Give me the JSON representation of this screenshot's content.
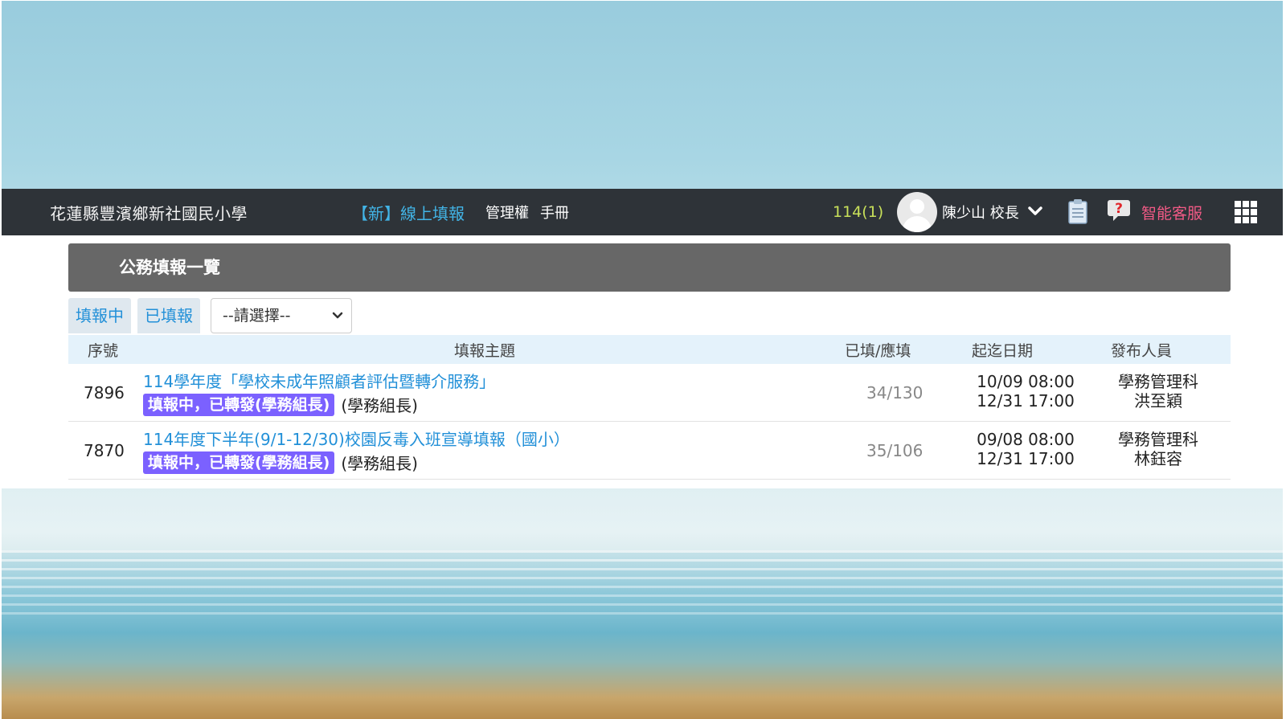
{
  "navbar": {
    "school_name": "花蓮縣豐濱鄉新社國民小學",
    "system_title": "【新】線上填報",
    "admin_link": "管理權",
    "manual_link": "手冊",
    "term": "114(1)",
    "user_name": "陳少山 校長",
    "ai_service": "智能客服",
    "icons": [
      "avatar-icon",
      "chevron-down-icon",
      "clipboard-icon",
      "help-icon",
      "apps-grid-icon"
    ]
  },
  "panel": {
    "title": "公務填報一覽"
  },
  "tabs": [
    {
      "label": "填報中"
    },
    {
      "label": "已填報"
    }
  ],
  "filter_select": {
    "selected": "--請選擇--"
  },
  "table": {
    "headers": {
      "id": "序號",
      "subject": "填報主題",
      "filled": "已填/應填",
      "period": "起迄日期",
      "publisher": "發布人員"
    },
    "rows": [
      {
        "id": "7896",
        "title": "114學年度「學校未成年照顧者評估暨轉介服務」",
        "status": "填報中，已轉發(學務組長)",
        "forwarded_to": "(學務組長)",
        "count": "34/130",
        "start": "10/09 08:00",
        "end": "12/31 17:00",
        "publisher_dept": "學務管理科",
        "publisher_name": "洪至穎"
      },
      {
        "id": "7870",
        "title": "114年度下半年(9/1-12/30)校園反毒入班宣導填報（國小）",
        "status": "填報中，已轉發(學務組長)",
        "forwarded_to": "(學務組長)",
        "count": "35/106",
        "start": "09/08 08:00",
        "end": "12/31 17:00",
        "publisher_dept": "學務管理科",
        "publisher_name": "林鈺容"
      }
    ]
  },
  "colors": {
    "navbar_bg": "#2e3338",
    "link_blue": "#2290d8",
    "badge_purple": "#7b61ff",
    "term_green": "#c8e05a",
    "ai_pink": "#f25a86",
    "panel_header_bg": "#676767"
  }
}
